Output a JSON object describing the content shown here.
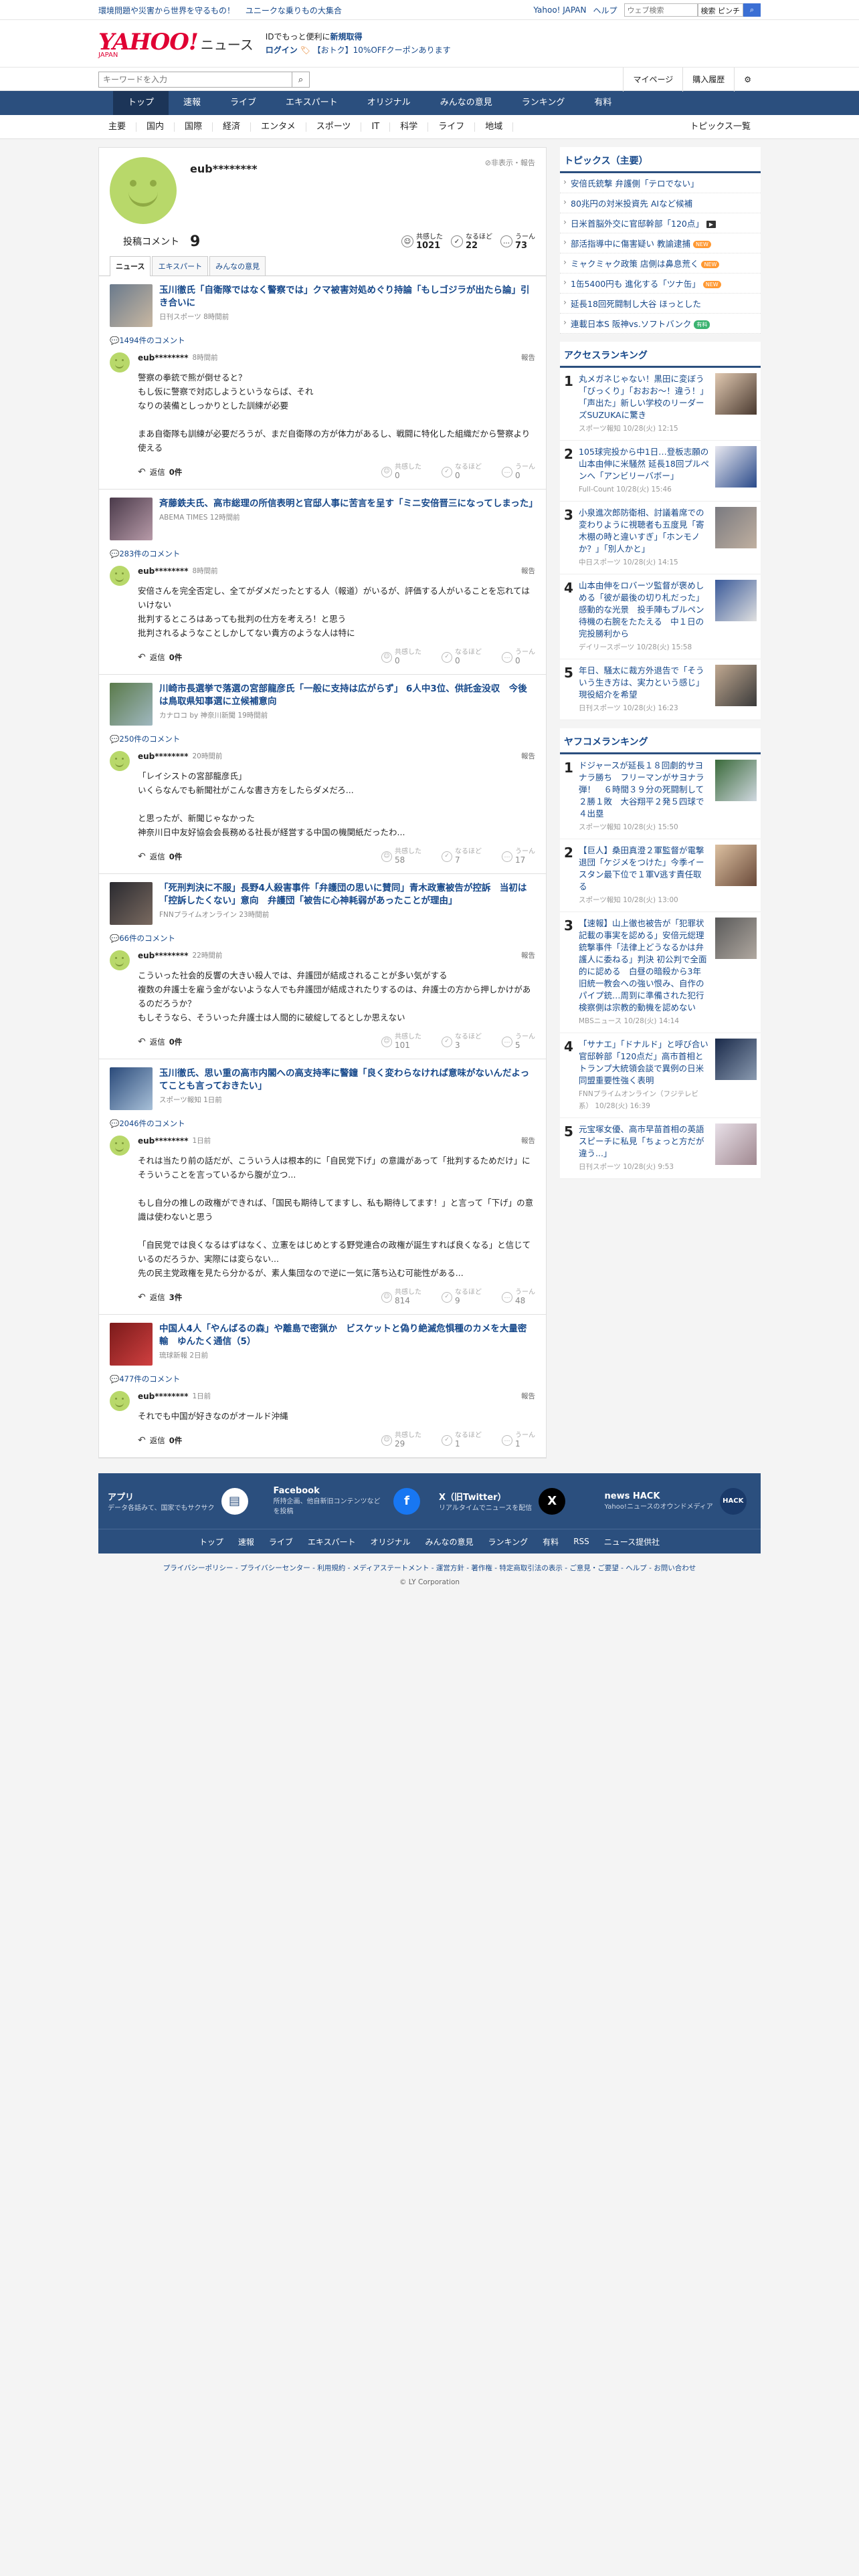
{
  "topbar": {
    "promos": [
      "環境問題や災害から世界を守るもの！",
      "ユニークな乗りもの大集合"
    ],
    "links": [
      "Yahoo! JAPAN",
      "ヘルプ"
    ],
    "search_placeholder": "ウェブ検索",
    "search_label": "検索",
    "search_kw": "ピンチ"
  },
  "masthead": {
    "logo_y": "YAHOO!",
    "logo_japan": "JAPAN",
    "logo_news": "ニュース",
    "line1": "IDでもっと便利に",
    "line1_link": "新規取得",
    "login": "ログイン",
    "coupon": "【おトク】10%OFFクーポンあります"
  },
  "searchrow": {
    "placeholder": "キーワードを入力",
    "mypage": "マイページ",
    "history": "購入履歴"
  },
  "nav": [
    "トップ",
    "速報",
    "ライブ",
    "エキスパート",
    "オリジナル",
    "みんなの意見",
    "ランキング",
    "有料"
  ],
  "subnav": [
    "主要",
    "国内",
    "国際",
    "経済",
    "エンタメ",
    "スポーツ",
    "IT",
    "科学",
    "ライフ",
    "地域"
  ],
  "subnav_all": "トピックス一覧",
  "profile": {
    "name": "eub********",
    "note": "非表示・報告",
    "comment_label": "投稿コメント",
    "comment_count": "9",
    "reactions": [
      {
        "icon": "☺",
        "label": "共感した",
        "value": "1021"
      },
      {
        "icon": "✓",
        "label": "なるほど",
        "value": "22"
      },
      {
        "icon": "…",
        "label": "うーん",
        "value": "73"
      }
    ],
    "tabs": [
      "ニュース",
      "エキスパート",
      "みんなの意見"
    ]
  },
  "posts": [
    {
      "title": "玉川徹氏「自衛隊ではなく警察では」クマ被害対処めぐり持論「もしゴジラが出たら論」引き合いに",
      "source": "日刊スポーツ 8時間前",
      "comments": "1494件のコメント",
      "user": "eub********",
      "time": "8時間前",
      "report": "報告",
      "text": "警察の拳銃で熊が倒せると？\nもし仮に警察で対応しようというならば、それ\nなりの装備としっかりとした訓練が必要\n\nまあ自衛隊も訓練が必要だろうが、まだ自衛隊の方が体力があるし、戦闘に特化した組織だから警察より使える",
      "reply": "返信",
      "reply_count": "0件",
      "r": [
        "0",
        "0",
        "0"
      ]
    },
    {
      "title": "斉藤鉄夫氏、高市総理の所信表明と官邸人事に苦言を呈す「ミニ安倍晋三になってしまった」",
      "source": "ABEMA TIMES 12時間前",
      "comments": "283件のコメント",
      "user": "eub********",
      "time": "8時間前",
      "report": "報告",
      "text": "安倍さんを完全否定し、全てがダメだったとする人（報道）がいるが、評価する人がいることを忘れてはいけない\n批判するところはあっても批判の仕方を考えろ！と思う\n批判されるようなことしかしてない貴方のような人は特に",
      "reply": "返信",
      "reply_count": "0件",
      "r": [
        "0",
        "0",
        "0"
      ]
    },
    {
      "title": "川崎市長選挙で落選の宮部龍彦氏「一般に支持は広がらず」 6人中3位、供託金没収　今後は鳥取県知事選に立候補意向",
      "source": "カナロコ by 神奈川新聞 19時間前",
      "comments": "250件のコメント",
      "user": "eub********",
      "time": "20時間前",
      "report": "報告",
      "text": "「レイシストの宮部龍彦氏」\nいくらなんでも新聞社がこんな書き方をしたらダメだろ...\n\nと思ったが、新聞じゃなかった\n神奈川日中友好協会会長務める社長が経営する中国の機関紙だったわ...",
      "reply": "返信",
      "reply_count": "0件",
      "r": [
        "58",
        "7",
        "17"
      ]
    },
    {
      "title": "「死刑判決に不服」長野4人殺害事件「弁護団の思いに賛同」青木政憲被告が控訴　当初は「控訴したくない」意向　弁護団「被告に心神耗弱があったことが理由」",
      "source": "FNNプライムオンライン 23時間前",
      "comments": "66件のコメント",
      "user": "eub********",
      "time": "22時間前",
      "report": "報告",
      "text": "こういった社会的反響の大きい殺人では、弁護団が結成されることが多い気がする\n複数の弁護士を雇う金がないような人でも弁護団が結成されたりするのは、弁護士の方から押しかけがあるのだろうか？\nもしそうなら、そういった弁護士は人間的に破綻してるとしか思えない",
      "reply": "返信",
      "reply_count": "0件",
      "r": [
        "101",
        "3",
        "5"
      ]
    },
    {
      "title": "玉川徹氏、思い重の高市内閣への高支持率に警鐘「良く変わらなければ意味がないんだよってことも言っておきたい」",
      "source": "スポーツ報知 1日前",
      "comments": "2046件のコメント",
      "user": "eub********",
      "time": "1日前",
      "report": "報告",
      "text": "それは当たり前の話だが、こういう人は根本的に「自民党下げ」の意識があって「批判するためだけ」にそういうことを言っているから腹が立つ...\n\nもし自分の推しの政権ができれば、「国民も期待してますし、私も期待してます！」と言って「下げ」の意識は使わないと思う\n\n「自民党では良くなるはずはなく、立憲をはじめとする野党連合の政権が誕生すれば良くなる」と信じているのだろうか、実際には変らない...\n先の民主党政権を見たら分かるが、素人集団なので逆に一気に落ち込む可能性がある...",
      "reply": "返信",
      "reply_count": "3件",
      "r": [
        "814",
        "9",
        "48"
      ]
    },
    {
      "title": "中国人4人「やんばるの森」や離島で密猟か　ビスケットと偽り絶滅危惧種のカメを大量密輸　ゆんたく通信（5）",
      "source": "琉球新報 2日前",
      "comments": "477件のコメント",
      "user": "eub********",
      "time": "1日前",
      "report": "報告",
      "text": "それでも中国が好きなのがオールド沖縄",
      "reply": "返信",
      "reply_count": "0件",
      "r": [
        "29",
        "1",
        "1"
      ]
    }
  ],
  "reaction_labels": [
    "共感した",
    "なるほど",
    "うーん"
  ],
  "sidebar": {
    "topics_title": "トピックス（主要）",
    "topics": [
      {
        "t": "安倍氏銃撃 弁護側「テロでない」",
        "b": ""
      },
      {
        "t": "80兆円の対米投資先 AIなど候補",
        "b": ""
      },
      {
        "t": "日米首脳外交に官邸幹部「120点」",
        "b": "k"
      },
      {
        "t": "部活指導中に傷害疑い 教諭逮捕",
        "b": "new"
      },
      {
        "t": "ミャクミャク政策 店側は鼻息荒く",
        "b": "new"
      },
      {
        "t": "1缶5400円も 進化する「ツナ缶」",
        "b": "new"
      },
      {
        "t": "延長18回死闘制し大谷 ほっとした",
        "b": ""
      },
      {
        "t": "連載日本S 阪神vs.ソフトバンク",
        "b": "g"
      }
    ],
    "badge_new": "NEW",
    "badge_g": "有料",
    "badge_k": "▶",
    "access_title": "アクセスランキング",
    "access": [
      {
        "t": "丸メガネじゃない！黒田に変ぼう「びっくり」「おおお～！違う！」「声出た」新しい学校のリーダーズSUZUKAに驚き",
        "s": "スポーツ報知 10/28(火) 12:15"
      },
      {
        "t": "105球完投から中1日…登板志願の山本由伸に米騒然 延長18回プルペンへ「アンビリーバボー」",
        "s": "Full-Count 10/28(火) 15:46"
      },
      {
        "t": "小泉進次郎防衛相、討議着席での変わりように視聴者も五度見「寄木棚の時と違いすぎ」「ホンモノか？」「別人かと」",
        "s": "中日スポーツ 10/28(火) 14:15"
      },
      {
        "t": "山本由伸をロバーツ監督が褒めしめる「彼が最後の切り札だった」感動的な光景　投手陣もブルペン待機の右腕をたたえる　中１日の完投勝利から",
        "s": "デイリースポーツ 10/28(火) 15:58"
      },
      {
        "t": "年日、騒太に裁方外退告で「そういう生き方は、実力という感じ」現役紹介を希望",
        "s": "日刊スポーツ 10/28(火) 16:23"
      }
    ],
    "yafuko_title": "ヤフコメランキング",
    "yafuko": [
      {
        "t": "ドジャースが延長１８回劇的サヨナラ勝ち　フリーマンがサヨナラ弾！　６時間３９分の死闘制して２勝１敗　大谷翔平２発５四球で４出塁",
        "s": "スポーツ報知 10/28(火) 15:50"
      },
      {
        "t": "【巨人】桑田真澄２軍監督が電撃退団「ケジメをつけた」今季イースタン最下位で１軍V逃す責任取る",
        "s": "スポーツ報知 10/28(火) 13:00"
      },
      {
        "t": "【速報】山上徹也被告が「犯罪状記載の事実を認める」安倍元総理銃撃事件「法律上どうなるかは弁護人に委ねる」判決 初公判で全面的に認める　白昼の暗殺から3年 旧統一教会への強い恨み、自作のパイプ銃…周到に準備された犯行 検察側は宗教的動機を認めない",
        "s": "MBSニュース 10/28(火) 14:14"
      },
      {
        "t": "「サナエ」「ドナルド」と呼び合い　官邸幹部「120点だ」高市首相とトランプ大統領会談で異例の日米同盟重要性強く表明",
        "s": "FNNプライムオンライン（フジテレビ系） 10/28(火) 16:39"
      },
      {
        "t": "元宝塚女優、高市早苗首相の英語スピーチに私見「ちょっと方だが違う...」",
        "s": "日刊スポーツ 10/28(火) 9:53"
      }
    ]
  },
  "footer": {
    "apps": [
      {
        "name": "アプリ",
        "desc": "データ各話みて、国家でもサクサク",
        "icon": "▤"
      },
      {
        "name": "Facebook",
        "desc": "所持企画、他自新旧コンテンツなどを投稿",
        "icon": "f"
      },
      {
        "name": "X（旧Twitter）",
        "desc": "リアルタイムでニュースを配信",
        "icon": "X"
      },
      {
        "name": "news HACK",
        "desc": "Yahoo!ニュースのオウンドメディア",
        "icon": "HACK"
      }
    ],
    "links": [
      "トップ",
      "速報",
      "ライブ",
      "エキスパート",
      "オリジナル",
      "みんなの意見",
      "ランキング",
      "有料",
      "RSS",
      "ニュース提供社"
    ],
    "legal": "プライバシーポリシー - プライバシーセンター - 利用規約 - メディアステートメント - 運営方針 - 著作権 - 特定商取引法の表示 - ご意見・ご要望 - ヘルプ - お問い合わせ",
    "copyright": "© LY Corporation"
  }
}
